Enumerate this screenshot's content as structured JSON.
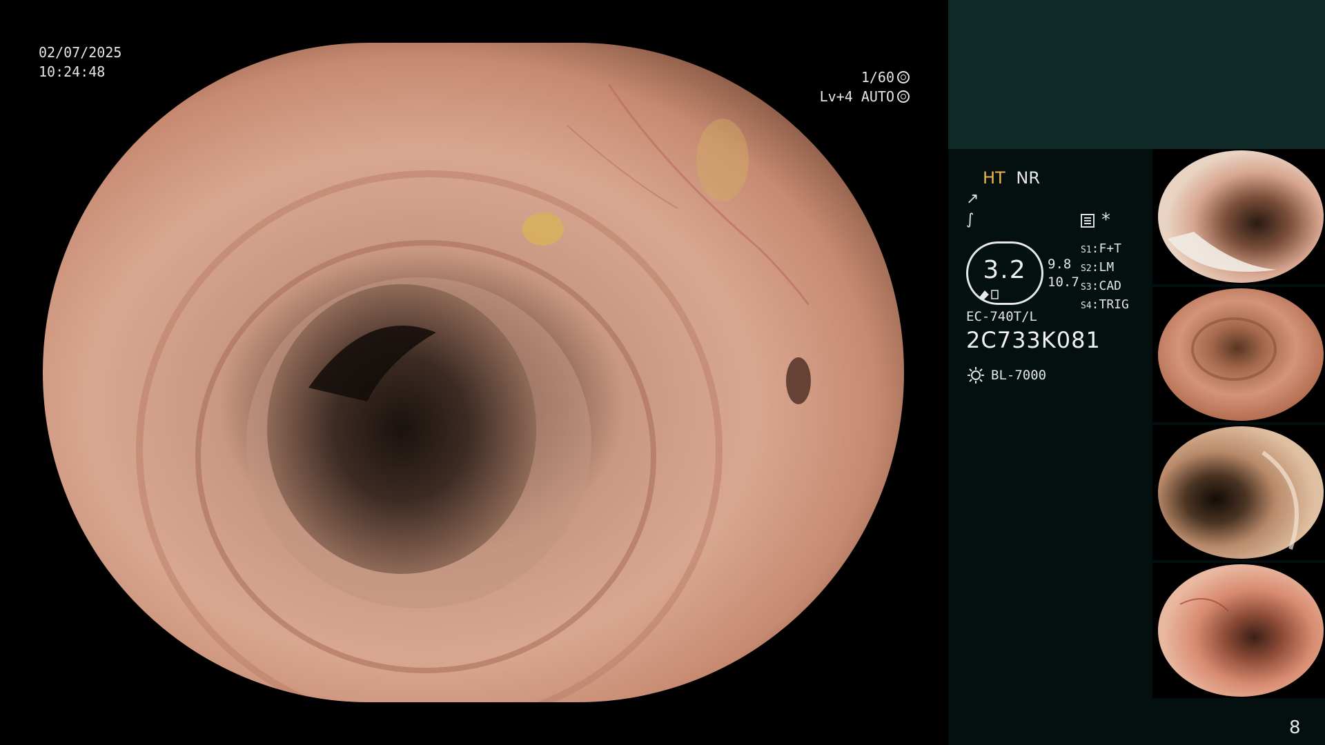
{
  "overlay": {
    "date": "02/07/2025",
    "time": "10:24:48",
    "shutter": "1/60",
    "level": "Lv+4 AUTO"
  },
  "panel": {
    "mode_ht": "HT",
    "mode_nr": "NR",
    "gauge_value": "3.2",
    "value_a": "9.8",
    "value_b": "10.7",
    "s1_key": "S1",
    "s1_val": "F+T",
    "s2_key": "S2",
    "s2_val": "LM",
    "s3_key": "S3",
    "s3_val": "CAD",
    "s4_key": "S4",
    "s4_val": "TRIG",
    "scope_model": "EC-740T/L",
    "scope_serial": "2C733K081",
    "light_source": "BL-7000",
    "page_number": "8"
  },
  "colors": {
    "ht_accent": "#f0b448",
    "panel_bg": "#03100f",
    "panel_top_bg": "#0e2926"
  },
  "icons": [
    "iris-icon",
    "auto-brightness-icon",
    "enhance-icon",
    "structure-icon",
    "list-icon",
    "asterisk-icon",
    "lamp-icon"
  ]
}
